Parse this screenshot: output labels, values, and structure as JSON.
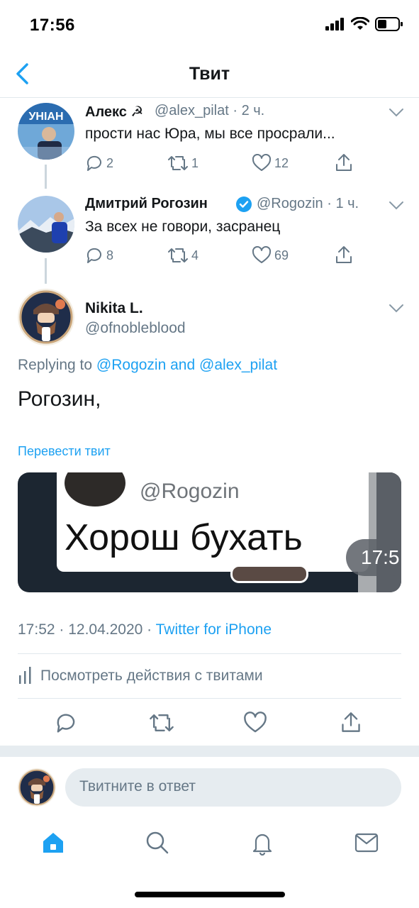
{
  "status_bar": {
    "time": "17:56"
  },
  "nav": {
    "title": "Твит"
  },
  "thread": [
    {
      "name": "Алекс ☭",
      "handle_time": "@alex_pilat · 2 ч.",
      "text": "прости нас Юра, мы все просрали...",
      "replies": "2",
      "retweets": "1",
      "likes": "12"
    },
    {
      "name": "Дмитрий Рогозин",
      "handle_time": "@Rogozin · 1 ч.",
      "text": "За всех не говори, засранец",
      "replies": "8",
      "retweets": "4",
      "likes": "69"
    }
  ],
  "main_tweet": {
    "name": "Nikita L.",
    "handle": "@ofnobleblood",
    "replying_prefix": "Replying to",
    "replying_user1": "@Rogozin",
    "replying_and": "and",
    "replying_user2": "@alex_pilat",
    "text": "Рогозин,",
    "translate": "Перевести твит",
    "media": {
      "handle": "@Rogozin",
      "caption": "Хорош бухать",
      "corner_time": "17:5"
    },
    "timestamp": "17:52 · 12.04.2020 · ",
    "source": "Twitter for iPhone",
    "activity": "Посмотреть действия с твитами"
  },
  "reply_bar": {
    "placeholder": "Твитните в ответ"
  },
  "avatar_banner": "УНІАН",
  "colors": {
    "accent": "#1da1f2",
    "muted": "#657786",
    "divider": "#e1e8ed"
  }
}
